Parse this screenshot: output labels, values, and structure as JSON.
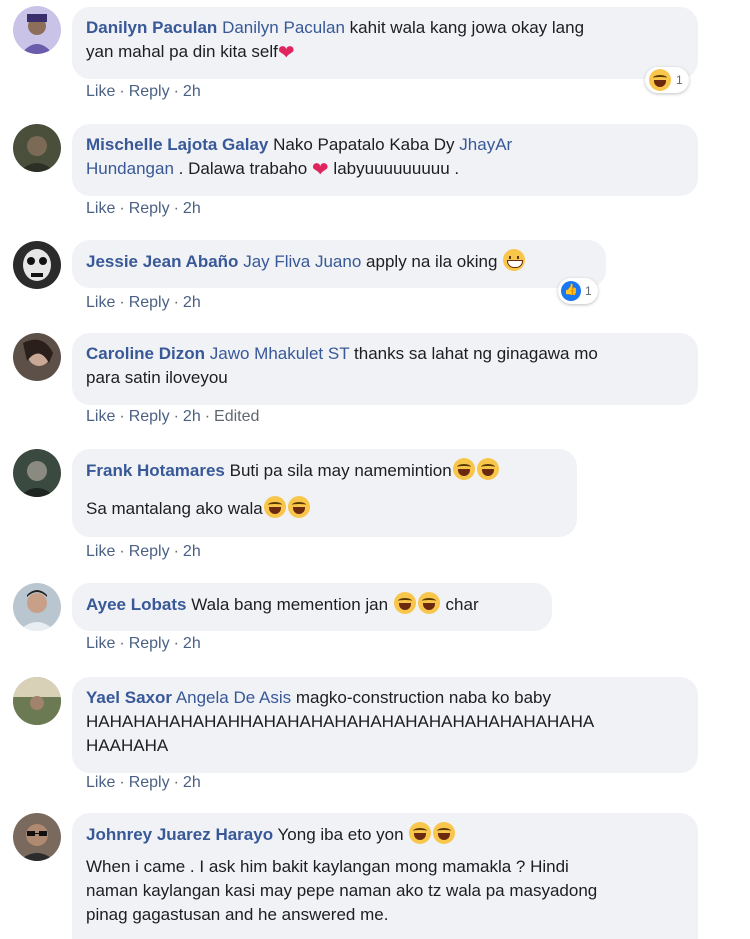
{
  "actions": {
    "like": "Like",
    "reply": "Reply",
    "sep": "·"
  },
  "comments": [
    {
      "author": "Danilyn Paculan",
      "mention": "Danilyn Paculan",
      "text1": "kahit wala kang jowa okay lang",
      "text2": "yan mahal pa din kita self",
      "time": "2h",
      "reaction_count": "1",
      "avatar_color": "#c9c3e8"
    },
    {
      "author": "Mischelle Lajota Galay",
      "text1": "Nako Papatalo Kaba Dy",
      "mention1": "JhayAr",
      "mention2": "Hundangan",
      "text2": ". Dalawa trabaho",
      "text3": "labyuuuuuuuuu .",
      "time": "2h",
      "avatar_color": "#4a4f3c"
    },
    {
      "author": "Jessie Jean Abaño",
      "mention": "Jay Fliva Juano",
      "text1": "apply na ila oking",
      "time": "2h",
      "reaction_count": "1",
      "avatar_color": "#2b2b2b"
    },
    {
      "author": "Caroline Dizon",
      "mention": "Jawo Mhakulet ST",
      "text1": "thanks sa lahat ng ginagawa mo",
      "text2": "para satin iloveyou",
      "time": "2h",
      "edited": "Edited",
      "avatar_color": "#5d5048"
    },
    {
      "author": "Frank Hotamares",
      "text1": "Buti pa sila may namemintion",
      "text2": "Sa mantalang ako wala",
      "time": "2h",
      "avatar_color": "#3a4a40"
    },
    {
      "author": "Ayee Lobats",
      "text1": "Wala bang memention jan",
      "text2": "char",
      "time": "2h",
      "avatar_color": "#b9c6cf"
    },
    {
      "author": "Yael Saxor",
      "mention": "Angela De Asis",
      "text1": "magko-construction naba ko baby",
      "text2": "HAHAHAHAHAHAHHAHAHAHAHAHAHAHAHAHAHAHAHAHAHA",
      "text3": "HAAHAHA",
      "time": "2h",
      "avatar_color": "#8a9a7a"
    },
    {
      "author": "Johnrey Juarez Harayo",
      "text1": "Yong iba eto yon",
      "text2": "When i came . I ask him bakit kaylangan mong mamakla ? Hindi",
      "text3": "naman kaylangan kasi may pepe naman ako tz wala pa masyadong",
      "text4": "pinag gagastusan and he answered me.",
      "avatar_color": "#7a6a5e"
    }
  ]
}
